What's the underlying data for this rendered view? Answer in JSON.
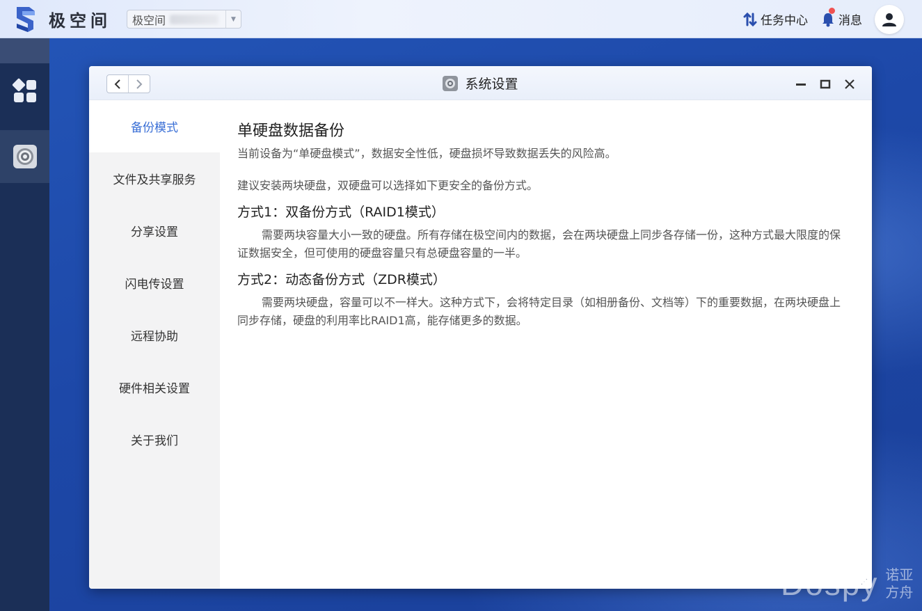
{
  "topbar": {
    "brand": "极空间",
    "device_name": "极空间",
    "task_center": "任务中心",
    "messages": "消息"
  },
  "window": {
    "title": "系统设置",
    "back_icon": "chevron-left-icon",
    "forward_icon": "chevron-right-icon",
    "selected_index": 0,
    "sidebar": {
      "items": [
        {
          "label": "备份模式"
        },
        {
          "label": "文件及共享服务"
        },
        {
          "label": "分享设置"
        },
        {
          "label": "闪电传设置"
        },
        {
          "label": "远程协助"
        },
        {
          "label": "硬件相关设置"
        },
        {
          "label": "关于我们"
        }
      ]
    },
    "content": {
      "title": "单硬盘数据备份",
      "intro": "当前设备为“单硬盘模式”，数据安全性低，硬盘损坏导致数据丢失的风险高。",
      "suggestion": "建议安装两块硬盘，双硬盘可以选择如下更安全的备份方式。",
      "mode1_title": "方式1：双备份方式（RAID1模式）",
      "mode1_desc": "需要两块容量大小一致的硬盘。所有存储在极空间内的数据，会在两块硬盘上同步各存储一份，这种方式最大限度的保证数据安全，但可使用的硬盘容量只有总硬盘容量的一半。",
      "mode2_title": "方式2：动态备份方式（ZDR模式）",
      "mode2_desc": "需要两块硬盘，容量可以不一样大。这种方式下，会将特定目录（如相册备份、文档等）下的重要数据，在两块硬盘上同步存储，硬盘的利用率比RAID1高，能存储更多的数据。"
    }
  },
  "watermark": {
    "latin": "Dospy",
    "cn_line1": "诺亚",
    "cn_line2": "方舟"
  },
  "colors": {
    "accent": "#3a6fd6",
    "desktop": "#1f4aa3",
    "dock": "#1b2f57",
    "notify": "#f05252"
  }
}
